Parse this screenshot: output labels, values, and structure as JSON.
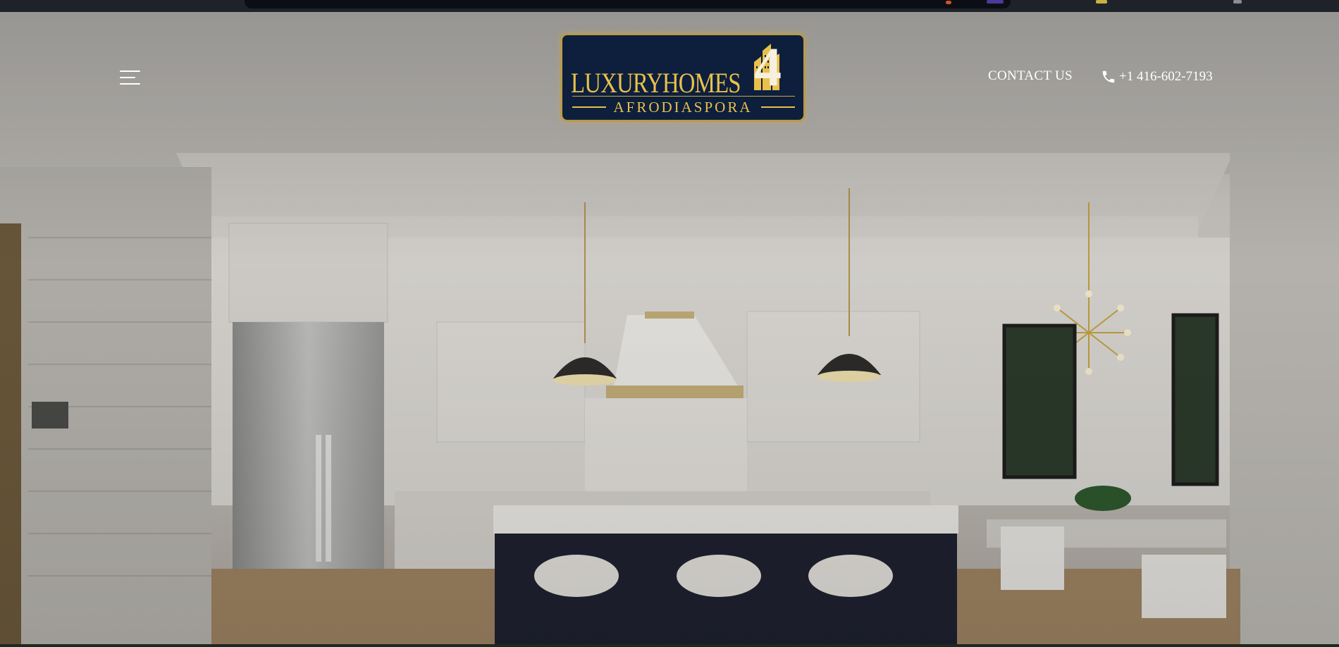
{
  "header": {
    "menu_icon": "hamburger-menu-icon",
    "logo": {
      "main_text": "LUXURYHOMES",
      "number": "4",
      "sub_text": "AFRODIASPORA",
      "colors": {
        "background": "#0d1f3d",
        "gold": "#e9c04a",
        "number": "#f5f0e0"
      }
    },
    "contact_label": "CONTACT US",
    "phone_icon": "phone-icon",
    "phone_number": "+1 416-602-7193"
  },
  "hero": {
    "scene": "luxury white kitchen with dark island, pendant lights and dining area"
  },
  "colors": {
    "text": "#ffffff",
    "accent_gold": "#e9c04a",
    "island_dark": "#1c1f2e"
  }
}
